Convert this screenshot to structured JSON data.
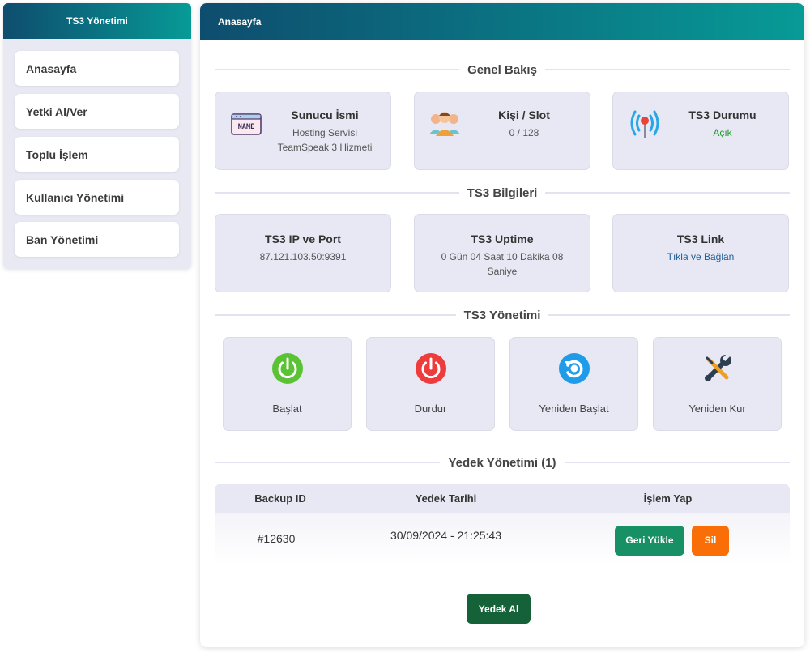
{
  "sidebar": {
    "title": "TS3 Yönetimi",
    "items": [
      {
        "label": "Anasayfa"
      },
      {
        "label": "Yetki Al/Ver"
      },
      {
        "label": "Toplu İşlem"
      },
      {
        "label": "Kullanıcı Yönetimi"
      },
      {
        "label": "Ban Yönetimi"
      }
    ]
  },
  "main": {
    "title": "Anasayfa",
    "overview": {
      "title": "Genel Bakış",
      "server_name": {
        "title": "Sunucu İsmi",
        "line1": "Hosting Servisi",
        "line2": "TeamSpeak 3 Hizmeti",
        "badge": "NAME",
        "icon": "name-badge-icon"
      },
      "slots": {
        "title": "Kişi / Slot",
        "value": "0 / 128",
        "icon": "users-group-icon"
      },
      "status": {
        "title": "TS3 Durumu",
        "value": "Açık",
        "color": "#1a9a2a",
        "icon": "broadcast-icon"
      }
    },
    "info": {
      "title": "TS3 Bilgileri",
      "ip": {
        "title": "TS3 IP ve Port",
        "value": "87.121.103.50:9391"
      },
      "uptime": {
        "title": "TS3 Uptime",
        "line1": "0 Gün 04 Saat 10 Dakika 08",
        "line2": "Saniye"
      },
      "link": {
        "title": "TS3 Link",
        "value": "Tıkla ve Bağlan",
        "color": "#1f5f9a"
      }
    },
    "management": {
      "title": "TS3 Yönetimi",
      "actions": [
        {
          "label": "Başlat",
          "icon": "power-on-icon",
          "color": "#5bc236"
        },
        {
          "label": "Durdur",
          "icon": "power-off-icon",
          "color": "#ee3b3b"
        },
        {
          "label": "Yeniden Başlat",
          "icon": "restart-icon",
          "color": "#1e9be9"
        },
        {
          "label": "Yeniden Kur",
          "icon": "wrench-screwdriver-icon",
          "color": "#2c3e50"
        }
      ]
    },
    "backups": {
      "title": "Yedek Yönetimi (1)",
      "columns": [
        "Backup ID",
        "Yedek Tarihi",
        "İşlem Yap"
      ],
      "rows": [
        {
          "id": "#12630",
          "date": "30/09/2024 - 21:25:43",
          "restore_label": "Geri Yükle",
          "delete_label": "Sil"
        }
      ],
      "take_backup_label": "Yedek Al"
    }
  }
}
